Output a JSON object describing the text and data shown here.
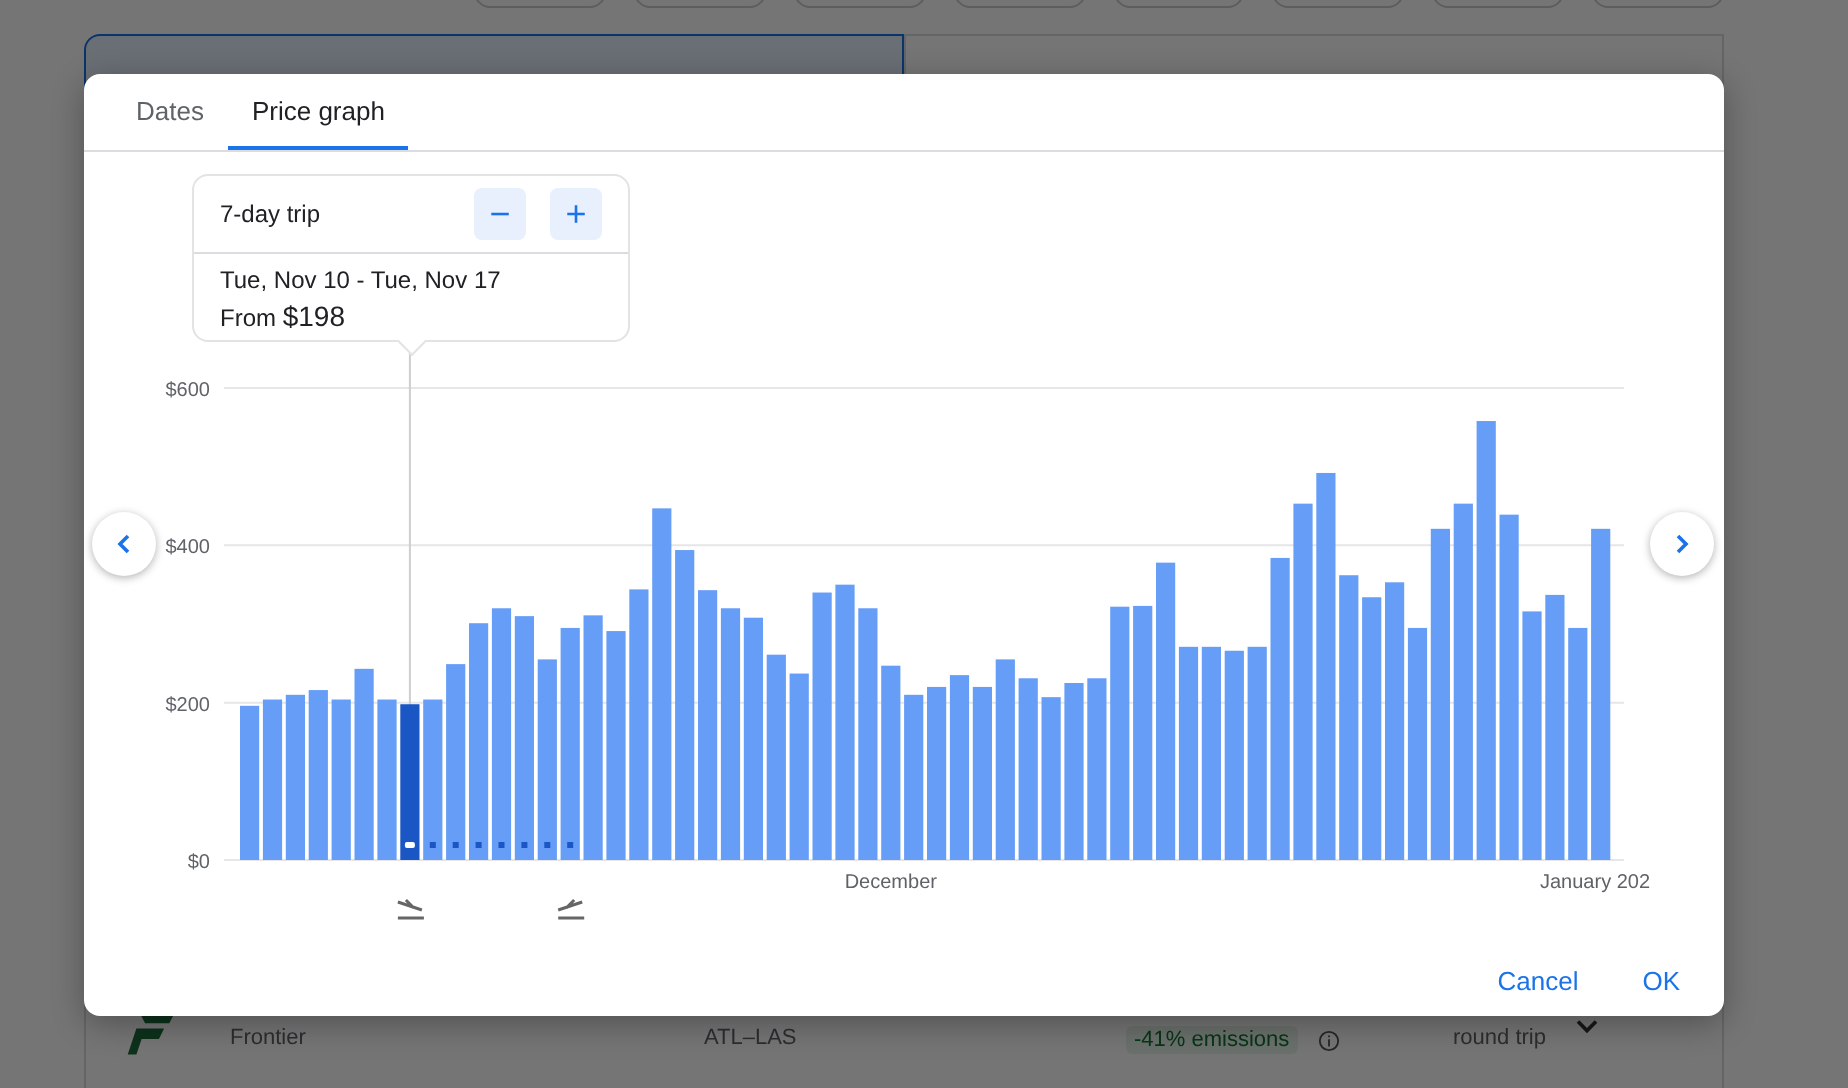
{
  "background": {
    "sort_tabs": [
      {
        "selected": true
      },
      {
        "selected": false
      }
    ],
    "flight": {
      "airline": "Frontier",
      "route": "ATL–LAS",
      "emissions_change": "-41% emissions",
      "price_note": "round trip"
    }
  },
  "dialog": {
    "tabs": [
      {
        "label": "Dates",
        "selected": false
      },
      {
        "label": "Price graph",
        "selected": true
      }
    ],
    "tooltip": {
      "trip_length": "7-day trip",
      "minus": "−",
      "plus": "+",
      "dates": "Tue, Nov 10 - Tue, Nov 17",
      "price_prefix": "From",
      "price": "$198"
    },
    "chart_data": {
      "type": "bar",
      "yticks": [
        {
          "value": 0,
          "label": "$0"
        },
        {
          "value": 200,
          "label": "$200"
        },
        {
          "value": 400,
          "label": "$400"
        },
        {
          "value": 600,
          "label": "$600"
        }
      ],
      "ylim": [
        0,
        600
      ],
      "categories": [
        null,
        null,
        null,
        null,
        null,
        null,
        null,
        null,
        null,
        null,
        null,
        null,
        null,
        null,
        null,
        null,
        null,
        null,
        null,
        null,
        null,
        null,
        null,
        null,
        null,
        null,
        null,
        null,
        "December",
        null,
        null,
        null,
        null,
        null,
        null,
        null,
        null,
        null,
        null,
        null,
        null,
        null,
        null,
        null,
        null,
        null,
        null,
        null,
        null,
        null,
        null,
        null,
        null,
        null,
        null,
        null,
        null,
        null,
        null,
        "January 202"
      ],
      "values": [
        196,
        204,
        210,
        216,
        204,
        243,
        204,
        198,
        204,
        249,
        301,
        320,
        310,
        255,
        295,
        311,
        291,
        344,
        447,
        394,
        343,
        320,
        308,
        261,
        237,
        340,
        350,
        320,
        247,
        210,
        220,
        235,
        220,
        255,
        231,
        207,
        225,
        231,
        322,
        323,
        378,
        271,
        271,
        266,
        271,
        384,
        453,
        492,
        362,
        334,
        353,
        295,
        421,
        453,
        558,
        439,
        316,
        337,
        295,
        421
      ]
    },
    "days": [
      {
        "selected": false,
        "in_trip": false
      },
      {
        "selected": false,
        "in_trip": false
      },
      {
        "selected": false,
        "in_trip": false
      },
      {
        "selected": false,
        "in_trip": false
      },
      {
        "selected": false,
        "in_trip": false
      },
      {
        "selected": false,
        "in_trip": false
      },
      {
        "selected": false,
        "in_trip": false
      },
      {
        "selected": true,
        "in_trip": false
      },
      {
        "selected": false,
        "in_trip": true
      },
      {
        "selected": false,
        "in_trip": true
      },
      {
        "selected": false,
        "in_trip": true
      },
      {
        "selected": false,
        "in_trip": true
      },
      {
        "selected": false,
        "in_trip": true
      },
      {
        "selected": false,
        "in_trip": true
      },
      {
        "selected": false,
        "in_trip": true
      }
    ],
    "buttons": [
      {
        "label": "Cancel"
      },
      {
        "label": "OK"
      }
    ]
  }
}
